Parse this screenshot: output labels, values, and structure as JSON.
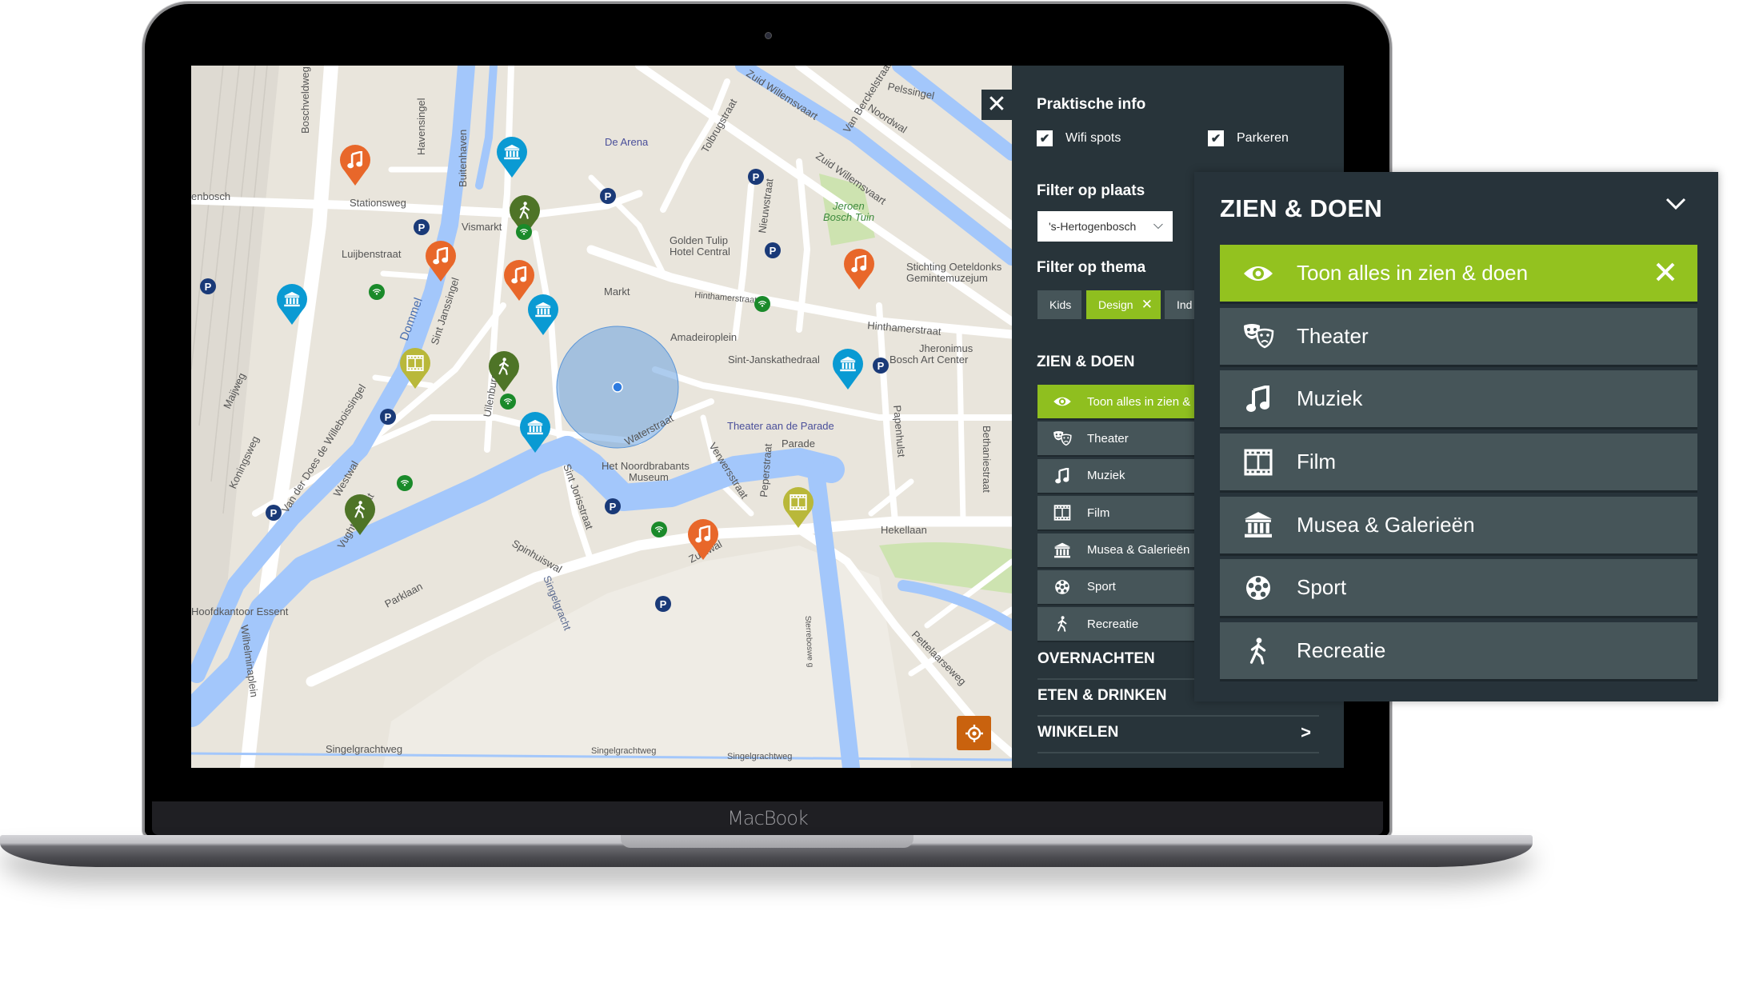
{
  "device": {
    "brand_label": "MacBook"
  },
  "map": {
    "labels": [
      "Stationsweg",
      "Luijbenstraat",
      "Vismarkt",
      "De Arena",
      "Golden Tulip",
      "Hotel Central",
      "Markt",
      "Amadeiroplein",
      "Sint-Janskathedraal",
      "Jheronimus",
      "Bosch Art Center",
      "Stichting Oeteldonks",
      "Gemintemuzejum",
      "Jeroen",
      "Bosch Tuin",
      "Hinthamerstraat",
      "Hinthamerstraat",
      "Theater aan de Parade",
      "Parade",
      "Het Noordbrabants",
      "Museum",
      "Waterstraat",
      "Hekellaan",
      "Zuidwal",
      "Parklaan",
      "Spinhuiswal",
      "Singelgracht",
      "Singelgrachtweg",
      "Singelgrachtweg",
      "Singelgrachtweg",
      "Hoofdkantoor Essent",
      "Pelssingel",
      "Noordwal",
      "Zuid Willemsvaart",
      "Zuid Willemsvaart",
      "Dommel",
      "Westwal",
      "Koningsweg",
      "Van der Does de Willeboissingel",
      "Boschveldweg",
      "Havensingel",
      "Buitenhaven",
      "Tolbrugstraat",
      "Nieuwstraat",
      "Papenhulst",
      "Bethaniestraat",
      "Pettelaarseweg",
      "Sint Jorisstraat",
      "Verwersstraat",
      "Peperstraat",
      "Uilenburg",
      "Sint Janssingel",
      "Maijweg",
      "Wilhelminaplein",
      "Van Berckelstraat",
      "Sterreboswe g",
      "Vughterstraat",
      "enbosch"
    ],
    "marker_colors": {
      "muziek": "#e8672a",
      "musea": "#0a9ad3",
      "recreatie": "#4e7427",
      "film": "#b9b83a",
      "wifi": "#1a8a2a",
      "parkeren": "#1a3a78"
    },
    "close_icon": "close-icon",
    "locate_icon": "crosshair-icon"
  },
  "sidebar": {
    "praktische_info": "Praktische info",
    "checkboxes": [
      {
        "label": "Wifi spots",
        "checked": true
      },
      {
        "label": "Parkeren",
        "checked": true
      }
    ],
    "filter_plaats": "Filter op plaats",
    "plaats_value": "'s-Hertogenbosch",
    "filter_thema": "Filter op thema",
    "tags": [
      {
        "label": "Kids",
        "active": false
      },
      {
        "label": "Design",
        "active": true
      },
      {
        "label": "Ind",
        "active": false
      }
    ],
    "section_zien": "ZIEN & DOEN",
    "items": [
      {
        "label": "Toon alles in zien & doen",
        "icon": "eye-icon",
        "active": true
      },
      {
        "label": "Theater",
        "icon": "theater-masks-icon"
      },
      {
        "label": "Muziek",
        "icon": "music-note-icon"
      },
      {
        "label": "Film",
        "icon": "film-icon"
      },
      {
        "label": "Musea & Galerieën",
        "icon": "museum-icon"
      },
      {
        "label": "Sport",
        "icon": "soccer-ball-icon"
      },
      {
        "label": "Recreatie",
        "icon": "walking-icon"
      }
    ],
    "sections": [
      {
        "label": "OVERNACHTEN"
      },
      {
        "label": "ETEN & DRINKEN"
      },
      {
        "label": "WINKELEN",
        "chevron": ">"
      }
    ]
  },
  "popup": {
    "title": "ZIEN & DOEN",
    "items": [
      {
        "label": "Toon alles in zien & doen",
        "icon": "eye-icon",
        "active": true
      },
      {
        "label": "Theater",
        "icon": "theater-masks-icon"
      },
      {
        "label": "Muziek",
        "icon": "music-note-icon"
      },
      {
        "label": "Film",
        "icon": "film-icon"
      },
      {
        "label": "Musea & Galerieën",
        "icon": "museum-icon"
      },
      {
        "label": "Sport",
        "icon": "soccer-ball-icon"
      },
      {
        "label": "Recreatie",
        "icon": "walking-icon"
      }
    ]
  },
  "colors": {
    "accent_green": "#8fbf1f",
    "panel": "#28343a",
    "item": "#465559",
    "locate": "#c9620e"
  }
}
